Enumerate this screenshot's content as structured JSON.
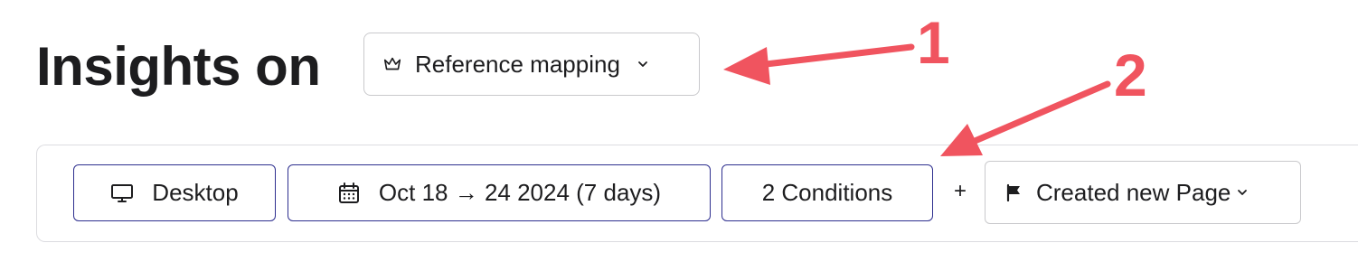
{
  "header": {
    "title": "Insights on",
    "selector": {
      "label": "Reference mapping",
      "icon": "crown-icon"
    }
  },
  "filters": {
    "device": {
      "label": "Desktop",
      "icon": "monitor-icon"
    },
    "date_range": {
      "label": "Oct 18 → 24 2024 (7 days)",
      "icon": "calendar-icon"
    },
    "conditions": {
      "label": "2 Conditions"
    },
    "plus": "+",
    "event": {
      "label": "Created new Page",
      "icon": "flag-icon"
    }
  },
  "annotations": {
    "first": "1",
    "second": "2",
    "color": "#f0545f"
  },
  "colors": {
    "pill_border": "#2e2f8f",
    "neutral_border": "#c9c9cc"
  }
}
